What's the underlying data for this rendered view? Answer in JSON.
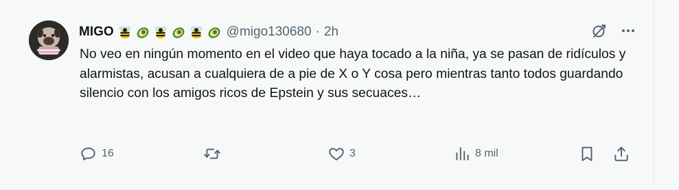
{
  "tweet": {
    "display_name": "MIGO",
    "handle": "@migo130680",
    "separator": "·",
    "time": "2h",
    "text": "No veo en ningún momento en el video que haya tocado a la niña, ya se pasan de ridículos y alarmistas, acusan a cualquiera de a pie de X o Y cosa pero mientras tanto todos guardando silencio con los amigos ricos de Epstein y sus secuaces…",
    "name_emojis": [
      "bee",
      "avocado",
      "bee",
      "avocado",
      "bee",
      "avocado"
    ]
  },
  "actions": {
    "replies": "16",
    "retweets": "",
    "likes": "3",
    "views": "8 mil"
  },
  "colors": {
    "text": "#0f1419",
    "secondary": "#536471",
    "background": "#f7f9f9"
  }
}
